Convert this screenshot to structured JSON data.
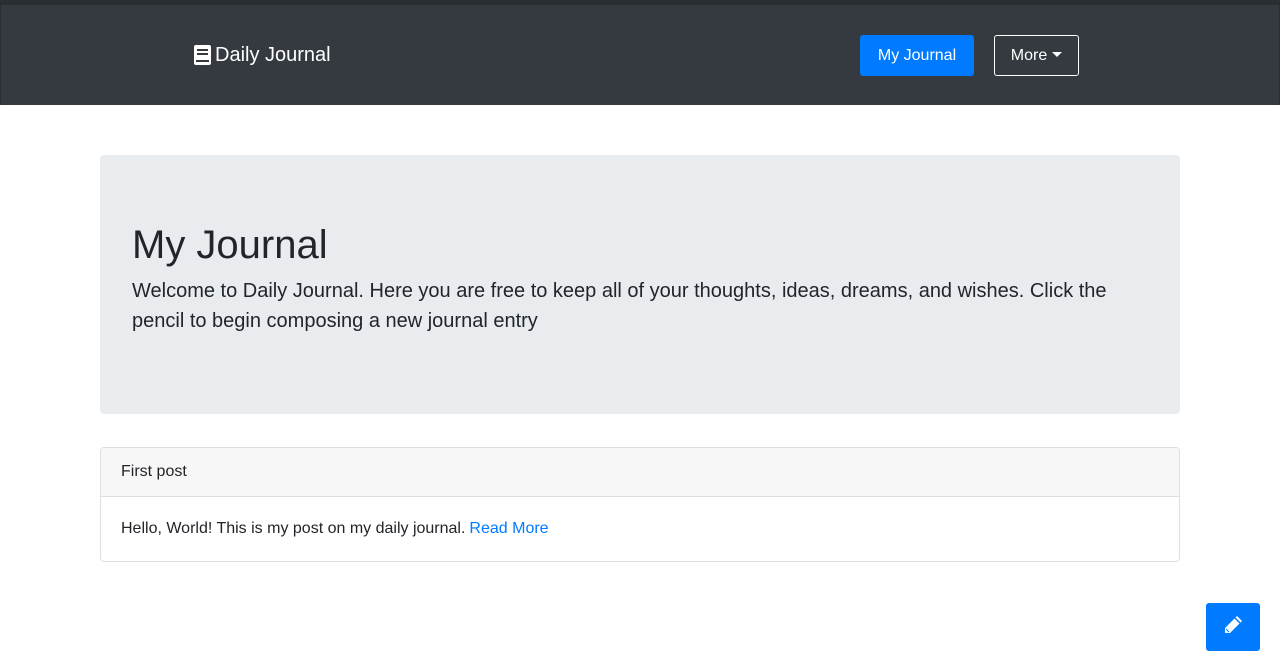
{
  "navbar": {
    "brand": {
      "icon": "book-icon",
      "label": "Daily Journal"
    },
    "primary_button_label": "My Journal",
    "more_button_label": "More"
  },
  "jumbotron": {
    "title": "My Journal",
    "lead": "Welcome to Daily Journal. Here you are free to keep all of your thoughts, ideas, dreams, and wishes. Click the pencil to begin composing a new journal entry"
  },
  "post": {
    "title": "First post",
    "body": "Hello, World! This is my post on my daily journal.",
    "read_more": "Read More"
  },
  "compose_button": {
    "icon": "pencil-icon"
  },
  "colors": {
    "navbar_bg": "#343a40",
    "primary": "#007bff",
    "jumbotron_bg": "#e9ecef"
  }
}
